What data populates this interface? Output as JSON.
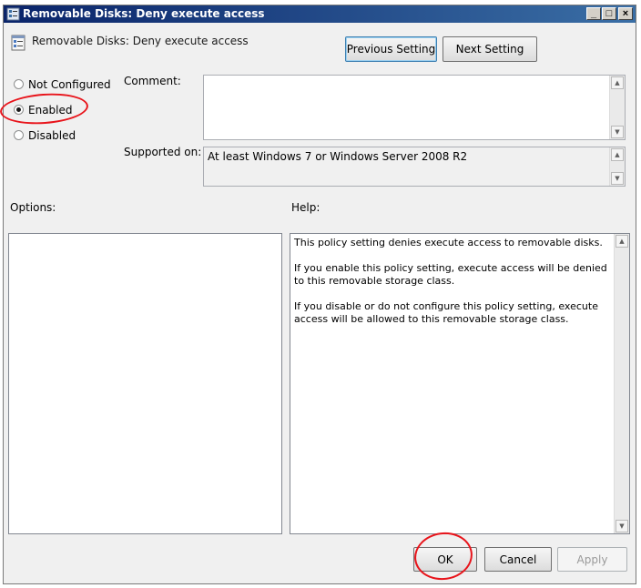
{
  "window": {
    "title": "Removable Disks: Deny execute access",
    "policy_name": "Removable Disks: Deny execute access",
    "minimize_glyph": "_",
    "maximize_glyph": "□",
    "close_glyph": "×"
  },
  "nav": {
    "previous_label": "Previous Setting",
    "next_label": "Next Setting"
  },
  "state": {
    "options": [
      {
        "label": "Not Configured",
        "checked": false
      },
      {
        "label": "Enabled",
        "checked": true
      },
      {
        "label": "Disabled",
        "checked": false
      }
    ]
  },
  "comment": {
    "label": "Comment:",
    "value": ""
  },
  "supported": {
    "label": "Supported on:",
    "value": "At least Windows 7 or Windows Server 2008 R2"
  },
  "options_section": {
    "label": "Options:"
  },
  "help": {
    "label": "Help:",
    "text": "This policy setting denies execute access to removable disks.\n\nIf you enable this policy setting, execute access will be denied to this removable storage class.\n\nIf you disable or do not configure this policy setting, execute access will be allowed to this removable storage class."
  },
  "footer": {
    "ok_label": "OK",
    "cancel_label": "Cancel",
    "apply_label": "Apply"
  },
  "icons": {
    "titlebar": "policy-icon",
    "policy": "policy-settings-icon"
  },
  "colors": {
    "annotation": "#e8141b",
    "titlebar": "#0a246a"
  }
}
